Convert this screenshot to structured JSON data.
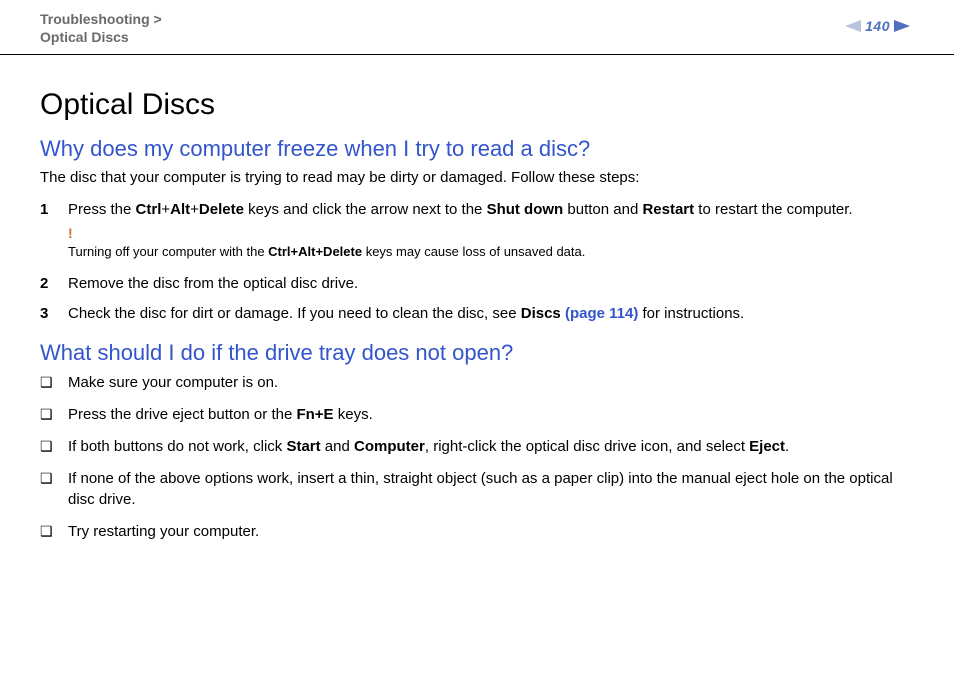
{
  "header": {
    "breadcrumb_line1": "Troubleshooting >",
    "breadcrumb_line2": "Optical Discs",
    "page_number": "140"
  },
  "title": "Optical Discs",
  "section1": {
    "question": "Why does my computer freeze when I try to read a disc?",
    "intro": "The disc that your computer is trying to read may be dirty or damaged. Follow these steps:",
    "steps": [
      {
        "num": "1",
        "pre": "Press the ",
        "kb1": "Ctrl",
        "plus1": "+",
        "kb2": "Alt",
        "plus2": "+",
        "kb3": "Delete",
        "mid1": " keys and click the arrow next to the ",
        "b1": "Shut down",
        "mid2": " button and ",
        "b2": "Restart",
        "post": " to restart the computer."
      },
      {
        "num": "2",
        "text": "Remove the disc from the optical disc drive."
      },
      {
        "num": "3",
        "pre": "Check the disc for dirt or damage. If you need to clean the disc, see ",
        "b1": "Discs ",
        "link": "(page 114)",
        "post": " for instructions."
      }
    ],
    "warning": {
      "mark": "!",
      "pre": "Turning off your computer with the ",
      "kb": "Ctrl+Alt+Delete",
      "post": " keys may cause loss of unsaved data."
    }
  },
  "section2": {
    "question": "What should I do if the drive tray does not open?",
    "bullet_glyph": "❑",
    "items": [
      {
        "text": "Make sure your computer is on."
      },
      {
        "pre": "Press the drive eject button or the ",
        "b1": "Fn+E",
        "post": " keys."
      },
      {
        "pre": "If both buttons do not work, click ",
        "b1": "Start",
        "mid1": " and ",
        "b2": "Computer",
        "mid2": ", right-click the optical disc drive icon, and select ",
        "b3": "Eject",
        "post": "."
      },
      {
        "text": "If none of the above options work, insert a thin, straight object (such as a paper clip) into the manual eject hole on the optical disc drive."
      },
      {
        "text": "Try restarting your computer."
      }
    ]
  }
}
